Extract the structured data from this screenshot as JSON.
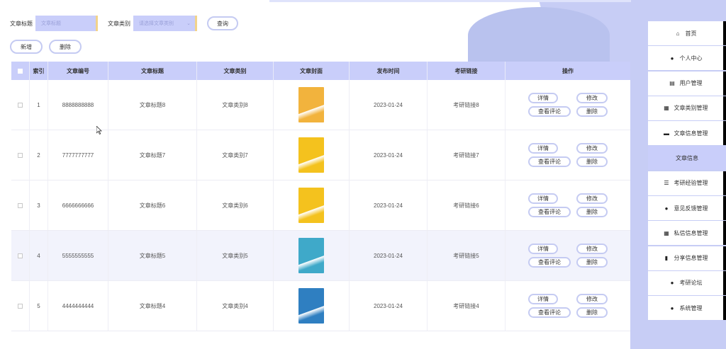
{
  "search": {
    "title_label": "文章标题",
    "title_placeholder": "文章标题",
    "category_label": "文章类别",
    "category_placeholder": "请选择文章类别",
    "query_button": "查询"
  },
  "toolbar": {
    "add_label": "新增",
    "delete_label": "删除"
  },
  "table": {
    "headers": [
      "",
      "索引",
      "文章编号",
      "文章标题",
      "文章类别",
      "文章封面",
      "发布时间",
      "考研链接",
      "操作"
    ],
    "rows": [
      {
        "index": "1",
        "code": "8888888888",
        "title": "文章标题8",
        "category": "文章类别8",
        "date": "2023-01-24",
        "link": "考研链接8",
        "cover_color": "#f2b33d"
      },
      {
        "index": "2",
        "code": "7777777777",
        "title": "文章标题7",
        "category": "文章类别7",
        "date": "2023-01-24",
        "link": "考研链接7",
        "cover_color": "#f4c21e"
      },
      {
        "index": "3",
        "code": "6666666666",
        "title": "文章标题6",
        "category": "文章类别6",
        "date": "2023-01-24",
        "link": "考研链接6",
        "cover_color": "#f4c21e"
      },
      {
        "index": "4",
        "code": "5555555555",
        "title": "文章标题5",
        "category": "文章类别5",
        "date": "2023-01-24",
        "link": "考研链接5",
        "cover_color": "#3fa9c9"
      },
      {
        "index": "5",
        "code": "4444444444",
        "title": "文章标题4",
        "category": "文章类别4",
        "date": "2023-01-24",
        "link": "考研链接4",
        "cover_color": "#2f7fc1"
      }
    ],
    "ops": {
      "detail": "详情",
      "edit": "修改",
      "comments": "查看评论",
      "delete": "删除"
    }
  },
  "sidebar": {
    "items": [
      {
        "label": "首页",
        "icon": "home-icon",
        "glyph": "⌂"
      },
      {
        "label": "个人中心",
        "icon": "user-icon",
        "glyph": "●"
      },
      {
        "label": "用户管理",
        "icon": "clipboard-icon",
        "glyph": "▤"
      },
      {
        "label": "文章类别管理",
        "icon": "grid-icon",
        "glyph": "▦"
      },
      {
        "label": "文章信息管理",
        "icon": "briefcase-icon",
        "glyph": "▬"
      },
      {
        "label": "文章信息",
        "icon": "",
        "glyph": ""
      },
      {
        "label": "考研经验管理",
        "icon": "list-icon",
        "glyph": "☰"
      },
      {
        "label": "意见反馈管理",
        "icon": "pin-icon",
        "glyph": "●"
      },
      {
        "label": "私信信息管理",
        "icon": "grid-icon",
        "glyph": "▦"
      },
      {
        "label": "分享信息管理",
        "icon": "chart-icon",
        "glyph": "▮"
      },
      {
        "label": "考研论坛",
        "icon": "user-icon",
        "glyph": "●"
      },
      {
        "label": "系统管理",
        "icon": "user-icon",
        "glyph": "●"
      }
    ]
  }
}
